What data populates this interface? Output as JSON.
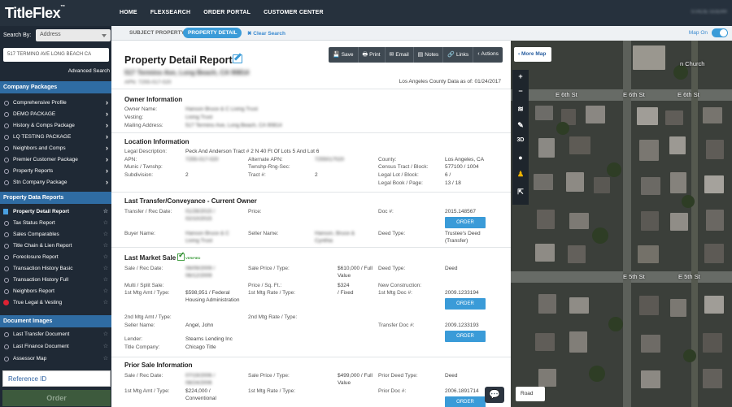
{
  "app": {
    "logo": "TitleFlex",
    "logo_mark": "™",
    "nav": [
      "HOME",
      "FLEXSEARCH",
      "ORDER PORTAL",
      "CUSTOMER CENTER"
    ],
    "user": "STACIE GUERR"
  },
  "sidebar": {
    "search_by_label": "Search By:",
    "search_by_value": "Address",
    "address_value": "517 TERMINO AVE LONG BEACH CA",
    "advanced_search": "Advanced Search",
    "company_packages": {
      "title": "Company Packages",
      "items": [
        "Comprehensive Profile",
        "DEMO PACKAGE",
        "History & Comps Package",
        "LQ TESTING PACKAGE",
        "Neighbors and Comps",
        "Premier Customer Package",
        "Property Reports",
        "Stn Company Package"
      ]
    },
    "property_data_reports": {
      "title": "Property Data Reports",
      "items": [
        "Property Detail Report",
        "Tax Status Report",
        "Sales Comparables",
        "Title Chain & Lien Report",
        "Foreclosure Report",
        "Transaction History Basic",
        "Transaction History Full",
        "Neighbors Report",
        "True Legal & Vesting"
      ]
    },
    "document_images": {
      "title": "Document Images",
      "items": [
        "Last Transfer Document",
        "Last Finance Document",
        "Assessor Map"
      ]
    },
    "reference_placeholder": "Reference ID",
    "order_label": "Order"
  },
  "tabs": {
    "subject": "SUBJECT PROPERTY",
    "detail": "PROPERTY DETAIL",
    "clear": "✖ Clear Search"
  },
  "report": {
    "title": "Property Detail Report",
    "address": "517 Termino Ave, Long Beach, CA 90814",
    "apn": "APN: 7255-017-020",
    "county_data": "Los Angeles County Data as of: 01/24/2017",
    "actions": [
      {
        "icon": "💾",
        "label": "Save"
      },
      {
        "icon": "🖶",
        "label": "Print"
      },
      {
        "icon": "✉",
        "label": "Email"
      },
      {
        "icon": "▤",
        "label": "Notes"
      },
      {
        "icon": "🔗",
        "label": "Links"
      },
      {
        "icon": "‹",
        "label": "Actions"
      }
    ],
    "owner": {
      "title": "Owner Information",
      "owner_name_label": "Owner Name:",
      "owner_name": "Hanson Bruce & C Living Trust",
      "vesting_label": "Vesting:",
      "vesting": "Living Trust",
      "mailing_label": "Mailing Address:",
      "mailing": "517 Termino Ave, Long Beach, CA 90814"
    },
    "location": {
      "title": "Location Information",
      "legal_desc_label": "Legal Description:",
      "legal_desc": "Peck And Anderson Tract # 2 N 40 Ft Of Lots 5 And Lot 6",
      "apn_label": "APN:",
      "apn": "7255-017-020",
      "alt_apn_label": "Alternate APN:",
      "alt_apn": "7255017020",
      "munic_label": "Munic / Twnshp:",
      "twnshp_label": "Twnshp-Rng-Sec:",
      "subdivision_label": "Subdivision:",
      "subdivision": "2",
      "tract_label": "Tract #:",
      "tract": "2",
      "county_label": "County:",
      "county": "Los Angeles, CA",
      "census_label": "Census Tract / Block:",
      "census": "577100 / 1004",
      "legal_lot_label": "Legal Lot / Block:",
      "legal_lot": "6 /",
      "legal_book_label": "Legal Book / Page:",
      "legal_book": "13 / 18"
    },
    "last_transfer": {
      "title": "Last Transfer/Conveyance - Current Owner",
      "transfer_label": "Transfer / Rec Date:",
      "transfer": "01/26/2015 / 02/10/2015",
      "price_label": "Price:",
      "doc_label": "Doc #:",
      "doc": "2015.148567",
      "order": "ORDER",
      "buyer_label": "Buyer Name:",
      "buyer": "Hanson Bruce & C Living Trust",
      "seller_label": "Seller Name:",
      "seller": "Hanson, Bruce & Cynthia",
      "deed_label": "Deed Type:",
      "deed": "Trustee's Deed (Transfer)"
    },
    "last_market": {
      "title": "Last Market Sale",
      "verified": "VERIFIED",
      "sale_label": "Sale / Rec Date:",
      "sale": "06/09/2009 / 06/12/2009",
      "sale_price_label": "Sale Price / Type:",
      "sale_price": "$610,000 / Full Value",
      "deed_label": "Deed Type:",
      "deed": "Deed",
      "multi_label": "Multi / Split Sale:",
      "price_sqft_label": "Price / Sq. Ft.:",
      "price_sqft": "$324",
      "new_const_label": "New Construction:",
      "mtg1_label": "1st Mtg Amt / Type:",
      "mtg1": "$598,951 / Federal Housing Administration",
      "mtg1_rate_label": "1st Mtg Rate / Type:",
      "mtg1_rate": "/ Fixed",
      "mtg1_doc_label": "1st Mtg Doc #:",
      "mtg1_doc": "2009.1233194",
      "order": "ORDER",
      "mtg2_label": "2nd Mtg Amt / Type:",
      "mtg2_rate_label": "2nd Mtg Rate / Type:",
      "seller_label": "Seller Name:",
      "seller": "Angel, John",
      "transfer_doc_label": "Transfer Doc #:",
      "transfer_doc": "2009.1233193",
      "lender_label": "Lender:",
      "lender": "Stearns Lending Inc",
      "title_co_label": "Title Company:",
      "title_co": "Chicago Title"
    },
    "prior_sale": {
      "title": "Prior Sale Information",
      "sale_label": "Sale / Rec Date:",
      "sale": "07/19/2006 / 08/24/2006",
      "sale_price_label": "Sale Price / Type:",
      "sale_price": "$499,000 / Full Value",
      "deed_label": "Prior Deed Type:",
      "deed": "Deed",
      "mtg1_label": "1st Mtg Amt / Type:",
      "mtg1": "$224,000 / Conventional",
      "mtg1_rate_label": "1st Mtg Rate / Type:",
      "doc_label": "Prior Doc #:",
      "doc": "2006.1891714",
      "order": "ORDER"
    }
  },
  "map": {
    "map_on": "Map On",
    "more_map": "More Map",
    "road": "Road",
    "streets": [
      "E 6th St",
      "E 6th St",
      "E 6th St",
      "E 5th St",
      "E 5th St"
    ],
    "church": "n Church",
    "tools": [
      "+",
      "−",
      "≋",
      "✎",
      "3D",
      "●",
      "♟",
      "⇱"
    ]
  }
}
